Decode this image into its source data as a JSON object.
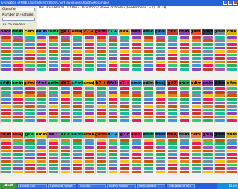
{
  "window": {
    "title": "Evaluation of MIDI Chord Identification Chord inversions Chord Sets samples"
  },
  "left_panel": {
    "classifier_label": "Classifier",
    "features_label": "Number of Features",
    "success_text": "72.7% success"
  },
  "status_text": "NN: Train 80.0% (100%) - Derivation / Power / Chroma (Biedermann (+1), -0.33)",
  "blocks": [
    {
      "headers": [
        "d#dr",
        "dmin",
        "c#m",
        "ddim",
        "f#mi",
        "g#7",
        "amaj",
        "c7 +",
        "g#mi",
        "f7 +",
        "d#ai",
        "f#mi",
        "amin",
        "g#di",
        "f#7",
        "fmin",
        "g#mi",
        "bdim",
        "gmin",
        "cma"
      ],
      "colors": [
        "#9b59b6",
        "#27ae60",
        "#f1c40f",
        "#3a9bd5",
        "#2ecc71",
        "#c0392b",
        "#e67e22",
        "#d35400",
        "#e91e63",
        "#1abc9c",
        "#f39c12",
        "#8e44ad",
        "#16a085",
        "#2980b9",
        "#c0392b",
        "#8e44ad",
        "#e74c3c",
        "#2c3e50",
        "#7f8c8d",
        "#d4ac0d"
      ]
    },
    {
      "headers": [
        "c#dim",
        "bmin",
        "g#mi",
        "f#mi",
        "amin",
        "d#7",
        "a#mi",
        "amaj",
        "b7 +",
        "f#dim",
        "e7 +",
        "emin",
        "adim",
        "fmaj",
        "g#7",
        "amin",
        "adim",
        "cmin",
        "ddim",
        "c#m"
      ],
      "colors": [
        "#16a085",
        "#2ecc71",
        "#e67e22",
        "#9b59b6",
        "#27ae60",
        "#c0392b",
        "#1abc9c",
        "#f1c40f",
        "#d35400",
        "#8e44ad",
        "#e91e63",
        "#3a9bd5",
        "#7f8c8d",
        "#2980b9",
        "#c0392b",
        "#27ae60",
        "#e67e22",
        "#8e44ad",
        "#2c3e50",
        "#d4ac0d"
      ]
    },
    {
      "headers": [
        "cdim",
        "amaj",
        "g#d",
        "dmin",
        "a#7",
        "a7 c",
        "a#mi",
        "amin",
        "g#mi",
        "d7 +",
        "g7 c",
        "a#di",
        "adim",
        "fmin",
        "bmaj",
        "fdim",
        "c#mi",
        "gmaj",
        "gmin",
        "d#m"
      ],
      "colors": [
        "#c0392b",
        "#e74c3c",
        "#2ecc71",
        "#f1c40f",
        "#9b59b6",
        "#27ae60",
        "#1abc9c",
        "#e67e22",
        "#d35400",
        "#3a9bd5",
        "#8e44ad",
        "#e91e63",
        "#16a085",
        "#2980b9",
        "#c0392b",
        "#7f8c8d",
        "#e67e22",
        "#8e44ad",
        "#2c3e50",
        "#d4ac0d"
      ]
    }
  ],
  "taskbar": {
    "start": "start",
    "items": [
      "Eclipse SDK",
      "Command Prompt",
      "CSOUND",
      "Search Results",
      "MIDI Chord ID",
      "Evaluation of MIDI"
    ],
    "clock": "12:00"
  }
}
